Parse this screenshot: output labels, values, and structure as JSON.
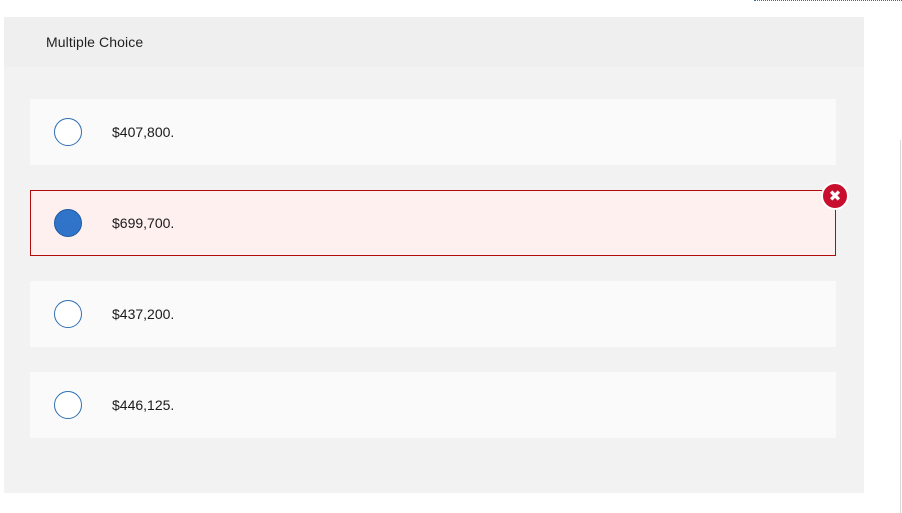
{
  "question": {
    "type_label": "Multiple Choice",
    "choices": [
      {
        "label": "$407,800.",
        "selected": false,
        "status": ""
      },
      {
        "label": "$699,700.",
        "selected": true,
        "status": "incorrect"
      },
      {
        "label": "$437,200.",
        "selected": false,
        "status": ""
      },
      {
        "label": "$446,125.",
        "selected": false,
        "status": ""
      }
    ],
    "feedback_icon": "x-mark-icon",
    "feedback_symbol": "✖"
  },
  "colors": {
    "accent_blue": "#2f74c9",
    "incorrect_red": "#c8102e",
    "incorrect_bg": "#fff0f0",
    "panel_bg": "#f2f2f2",
    "choice_bg": "#fafafa"
  }
}
